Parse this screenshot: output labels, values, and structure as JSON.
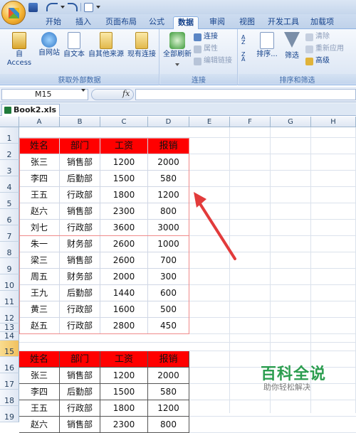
{
  "qat_icons": [
    "save-icon",
    "undo-icon",
    "redo-icon",
    "print-preview-icon"
  ],
  "tabs": [
    {
      "label": "开始",
      "active": false
    },
    {
      "label": "插入",
      "active": false
    },
    {
      "label": "页面布局",
      "active": false
    },
    {
      "label": "公式",
      "active": false
    },
    {
      "label": "数据",
      "active": true
    },
    {
      "label": "审阅",
      "active": false
    },
    {
      "label": "视图",
      "active": false
    },
    {
      "label": "开发工具",
      "active": false
    },
    {
      "label": "加载项",
      "active": false
    }
  ],
  "ribbon": {
    "external": {
      "group_label": "获取外部数据",
      "access": "自 Access",
      "web": "自网站",
      "text": "自文本",
      "other": "自其他来源",
      "existing": "现有连接"
    },
    "connections": {
      "group_label": "连接",
      "refresh_all": "全部刷新",
      "connections": "连接",
      "properties": "属性",
      "edit_links": "编辑链接"
    },
    "sort_filter": {
      "group_label": "排序和筛选",
      "sort": "排序...",
      "filter": "筛选",
      "clear": "清除",
      "reapply": "重新应用",
      "advanced": "高级"
    }
  },
  "formula_bar": {
    "name_box": "M15",
    "fx": "fx",
    "formula": ""
  },
  "workbook_tab": "Book2.xls *",
  "columns": [
    "A",
    "B",
    "C",
    "D",
    "E",
    "F",
    "G",
    "H"
  ],
  "rows": [
    "1",
    "2",
    "3",
    "4",
    "5",
    "6",
    "7",
    "8",
    "9",
    "10",
    "11",
    "12",
    "13",
    "14",
    "15",
    "16",
    "17",
    "18",
    "19"
  ],
  "table1": {
    "headers": [
      "姓名",
      "部门",
      "工资",
      "报销"
    ],
    "rows": [
      [
        "张三",
        "销售部",
        "1200",
        "2000"
      ],
      [
        "李四",
        "后勤部",
        "1500",
        "580"
      ],
      [
        "王五",
        "行政部",
        "1800",
        "1200"
      ],
      [
        "赵六",
        "销售部",
        "2300",
        "800"
      ],
      [
        "刘七",
        "行政部",
        "3600",
        "3000"
      ],
      [
        "朱一",
        "财务部",
        "2600",
        "1000"
      ],
      [
        "梁三",
        "销售部",
        "2600",
        "700"
      ],
      [
        "周五",
        "财务部",
        "2000",
        "300"
      ],
      [
        "王九",
        "后勤部",
        "1440",
        "600"
      ],
      [
        "黄三",
        "行政部",
        "1600",
        "500"
      ],
      [
        "赵五",
        "行政部",
        "2800",
        "450"
      ]
    ]
  },
  "table2": {
    "headers": [
      "姓名",
      "部门",
      "工资",
      "报销"
    ],
    "rows": [
      [
        "张三",
        "销售部",
        "1200",
        "2000"
      ],
      [
        "李四",
        "后勤部",
        "1500",
        "580"
      ],
      [
        "王五",
        "行政部",
        "1800",
        "1200"
      ],
      [
        "赵六",
        "销售部",
        "2300",
        "800"
      ]
    ]
  },
  "watermark": {
    "title": "百科全说",
    "subtitle": "助你轻松解决"
  },
  "colors": {
    "header_fill": "#ff0000",
    "ribbon_accent": "#15428b",
    "arrow": "#e23b3b",
    "watermark": "#2b9d4f"
  }
}
